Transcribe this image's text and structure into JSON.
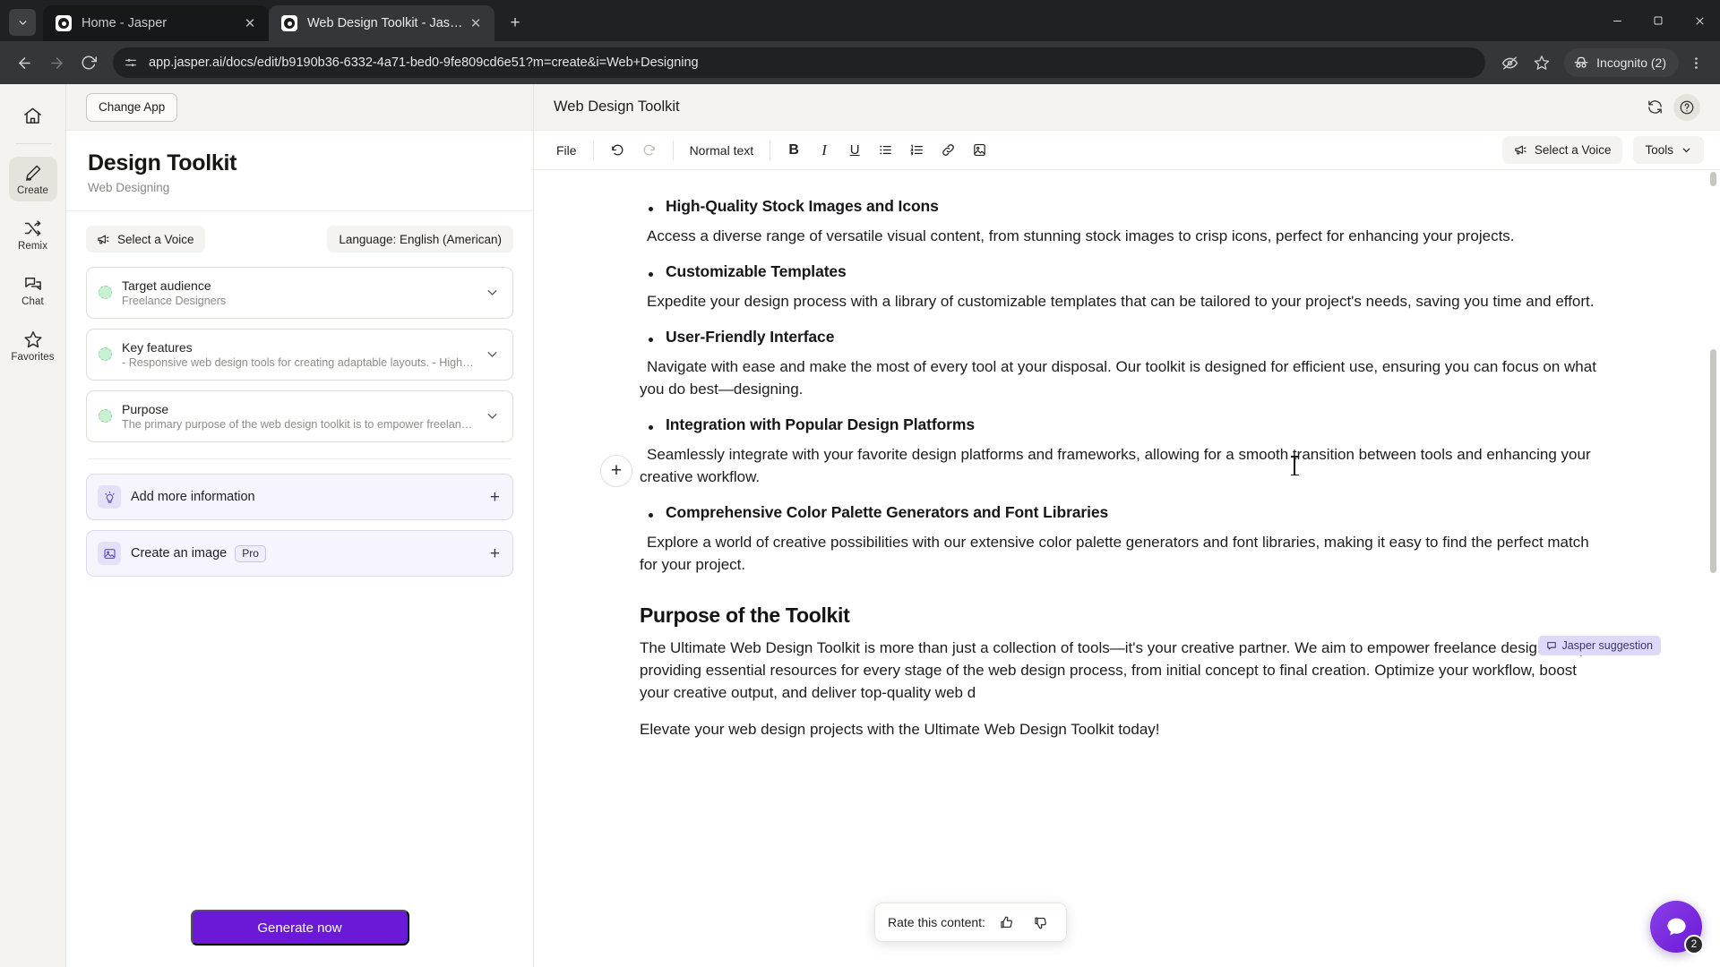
{
  "browser": {
    "tabs": [
      {
        "title": "Home - Jasper",
        "active": false
      },
      {
        "title": "Web Design Toolkit - Jasper",
        "active": true
      }
    ],
    "url": "app.jasper.ai/docs/edit/b9190b36-6332-4a71-bed0-9fe809cd6e51?m=create&i=Web+Designing",
    "incognito_label": "Incognito (2)",
    "new_tab_glyph": "+",
    "tab_close_glyph": "✕",
    "minimize_glyph": "─",
    "maximize_glyph": "☐",
    "close_glyph": "✕"
  },
  "rail": {
    "home_label": "Home",
    "items": [
      {
        "label": "Create",
        "icon": "pencil-icon",
        "active": true
      },
      {
        "label": "Remix",
        "icon": "shuffle-icon",
        "active": false
      },
      {
        "label": "Chat",
        "icon": "chat-bubbles-icon",
        "active": false
      },
      {
        "label": "Favorites",
        "icon": "star-icon",
        "active": false
      }
    ]
  },
  "left_panel": {
    "change_app_label": "Change App",
    "title": "Design Toolkit",
    "subtitle": "Web Designing",
    "voice_label": "Select a Voice",
    "language_label": "Language: English (American)",
    "fields": [
      {
        "label": "Target audience",
        "value": "Freelance Designers"
      },
      {
        "label": "Key features",
        "value": "- Responsive web design tools for creating adaptable layouts. - High-qualit..."
      },
      {
        "label": "Purpose",
        "value": "The primary purpose of the web design toolkit is to empower freelance desi..."
      }
    ],
    "actions": [
      {
        "label": "Add more information",
        "icon": "lightbulb-icon",
        "badge": "",
        "plus": "+"
      },
      {
        "label": "Create an image",
        "icon": "image-icon",
        "badge": "Pro",
        "plus": "+"
      }
    ],
    "generate_label": "Generate now"
  },
  "editor": {
    "doc_title": "Web Design Toolkit",
    "header_icons": [
      {
        "name": "refresh-icon"
      },
      {
        "name": "help-icon"
      }
    ],
    "toolbar": {
      "file_label": "File",
      "undo_glyph": "↶",
      "redo_glyph": "↷",
      "style_label": "Normal text",
      "bold_label": "B",
      "italic_label": "I",
      "underline_label": "U",
      "bullet_list_name": "bulleted-list-icon",
      "numbered_list_name": "numbered-list-icon",
      "link_name": "link-icon",
      "image_name": "image-icon",
      "select_voice_label": "Select a Voice",
      "tools_label": "Tools",
      "tools_chevron": "▾"
    },
    "document": {
      "blocks": [
        {
          "type": "bullet",
          "text": "High-Quality Stock Images and Icons"
        },
        {
          "type": "paragraph",
          "text": "Access a diverse range of versatile visual content, from stunning stock images to crisp icons, perfect for enhancing your projects."
        },
        {
          "type": "bullet",
          "text": "Customizable Templates"
        },
        {
          "type": "paragraph",
          "text": "Expedite your design process with a library of customizable templates that can be tailored to your project's needs, saving you time and effort."
        },
        {
          "type": "bullet",
          "text": "User-Friendly Interface"
        },
        {
          "type": "paragraph",
          "text": "Navigate with ease and make the most of every tool at your disposal. Our toolkit is designed for efficient use, ensuring you can focus on what you do best—designing."
        },
        {
          "type": "bullet",
          "text": "Integration with Popular Design Platforms"
        },
        {
          "type": "paragraph",
          "text": "Seamlessly integrate with your favorite design platforms and frameworks, allowing for a smooth transition between tools and enhancing your creative workflow."
        },
        {
          "type": "bullet",
          "text": "Comprehensive Color Palette Generators and Font Libraries"
        },
        {
          "type": "paragraph",
          "text": "Explore a world of creative possibilities with our extensive color palette generators and font libraries, making it easy to find the perfect match for your project."
        },
        {
          "type": "heading",
          "text": "Purpose of the Toolkit"
        },
        {
          "type": "paragraph-plain",
          "text": "The Ultimate Web Design Toolkit is more than just a collection of tools—it's your creative partner. We aim to empower freelance designers by providing essential resources for every stage of the web design process, from initial concept to final creation. Optimize your workflow, boost your creative output, and deliver top-quality web d"
        },
        {
          "type": "paragraph-plain",
          "text": "Elevate your web design projects with the Ultimate Web Design Toolkit today!"
        }
      ]
    },
    "suggestion_badge": "Jasper suggestion",
    "rate_popup": {
      "label": "Rate this content:",
      "thumbs_up_name": "thumbs-up-icon",
      "thumbs_down_name": "thumbs-down-icon"
    },
    "chat_fab_badge": "2",
    "plus_fab_glyph": "+"
  },
  "colors": {
    "accent_purple": "#6b19d6",
    "suggestion_bg": "#ded9fb",
    "panel_bg": "#f4f3f0",
    "dot_green": "#c9f0d3"
  }
}
